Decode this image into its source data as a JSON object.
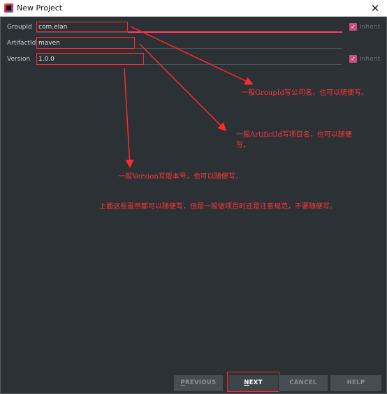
{
  "window": {
    "title": "New Project",
    "close_glyph": "✕",
    "icon": "intellij-app-icon"
  },
  "fields": [
    {
      "label": "GroupId",
      "value": "com.elan",
      "inherit": "Inherit"
    },
    {
      "label": "ArtifactId",
      "value": "maven"
    },
    {
      "label": "Version",
      "value": "1.0.0",
      "inherit": "Inherit"
    }
  ],
  "annotations": {
    "group": "一般GroupId写公司名，也可以随便写。",
    "artifact_line1": "一般ArtifictId写项目名，也可以随便",
    "artifact_line2": "写。",
    "version": "一般Version写版本号，也可以随便写。",
    "general": "上面这些虽然都可以随便写，但是一般做项目时还是注意规范，不要随便写。"
  },
  "buttons": {
    "previous_mnemonic": "P",
    "previous_rest": "REVIOUS",
    "next_mnemonic": "N",
    "next_rest": "EXT",
    "cancel": "CANCEL",
    "help": "HELP"
  },
  "colors": {
    "accent": "#c8507a",
    "annotation": "#ff3838",
    "background": "#2b3135"
  }
}
